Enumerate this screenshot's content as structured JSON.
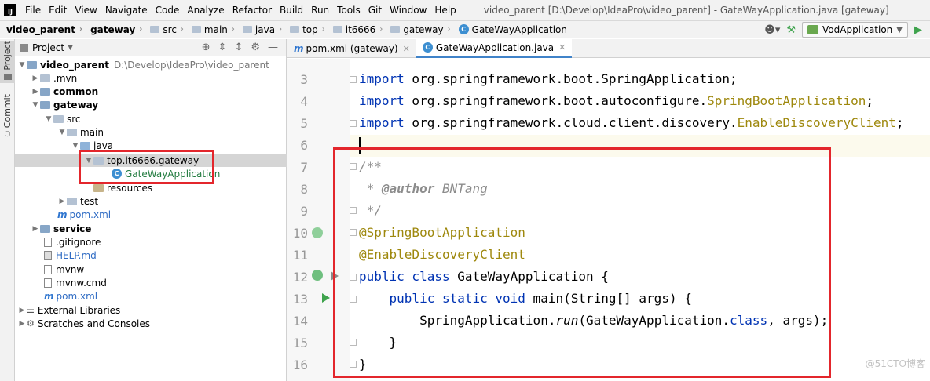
{
  "menu": {
    "items": [
      "File",
      "Edit",
      "View",
      "Navigate",
      "Code",
      "Analyze",
      "Refactor",
      "Build",
      "Run",
      "Tools",
      "Git",
      "Window",
      "Help"
    ],
    "window_title": "video_parent [D:\\Develop\\IdeaPro\\video_parent] - GateWayApplication.java [gateway]"
  },
  "breadcrumbs": [
    "video_parent",
    "gateway",
    "src",
    "main",
    "java",
    "top",
    "it6666",
    "gateway",
    "GateWayApplication"
  ],
  "run_config": {
    "label": "VodApplication"
  },
  "tool_stripe": {
    "project_label": "Project",
    "commit_label": "Commit"
  },
  "project_panel": {
    "title": "Project",
    "tree": [
      {
        "label": "video_parent",
        "hint": "D:\\Develop\\IdeaPro\\video_parent"
      },
      {
        "label": ".mvn"
      },
      {
        "label": "common"
      },
      {
        "label": "gateway"
      },
      {
        "label": "src"
      },
      {
        "label": "main"
      },
      {
        "label": "java"
      },
      {
        "label": "top.it6666.gateway"
      },
      {
        "label": "GateWayApplication"
      },
      {
        "label": "resources"
      },
      {
        "label": "test"
      },
      {
        "label": "pom.xml"
      },
      {
        "label": "service"
      },
      {
        "label": ".gitignore"
      },
      {
        "label": "HELP.md"
      },
      {
        "label": "mvnw"
      },
      {
        "label": "mvnw.cmd"
      },
      {
        "label": "pom.xml"
      },
      {
        "label": "External Libraries"
      },
      {
        "label": "Scratches and Consoles"
      }
    ]
  },
  "editor": {
    "tabs": [
      {
        "label": "pom.xml (gateway)"
      },
      {
        "label": "GateWayApplication.java"
      }
    ],
    "line_numbers": [
      "3",
      "4",
      "5",
      "6",
      "7",
      "8",
      "9",
      "10",
      "11",
      "12",
      "13",
      "14",
      "15",
      "16"
    ],
    "code": {
      "l3_kw": "import",
      "l3_rest": " org.springframework.boot.SpringApplication;",
      "l4_kw": "import",
      "l4_pkg": " org.springframework.boot.autoconfigure.",
      "l4_cls": "SpringBootApplication",
      "l4_end": ";",
      "l5_kw": "import",
      "l5_pkg": " org.springframework.cloud.client.discovery.",
      "l5_cls": "EnableDiscoveryClient",
      "l5_end": ";",
      "l7": "/**",
      "l8_a": " * ",
      "l8_tag": "@author",
      "l8_b": " BNTang",
      "l9": " */",
      "l10": "@SpringBootApplication",
      "l11": "@EnableDiscoveryClient",
      "l12_kw": "public class",
      "l12_rest": " GateWayApplication {",
      "l13_kw": "    public static void",
      "l13_rest": " main(String[] args) {",
      "l14_a": "        SpringApplication.",
      "l14_run": "run",
      "l14_b": "(GateWayApplication.",
      "l14_kw": "class",
      "l14_c": ", args);",
      "l15": "    }",
      "l16": "}"
    }
  },
  "watermark": "@51CTO博客",
  "colors": {
    "highlight": "#e3262c",
    "keyword": "#0033b3",
    "annotation": "#9e880d",
    "comment": "#8c8c8c"
  }
}
